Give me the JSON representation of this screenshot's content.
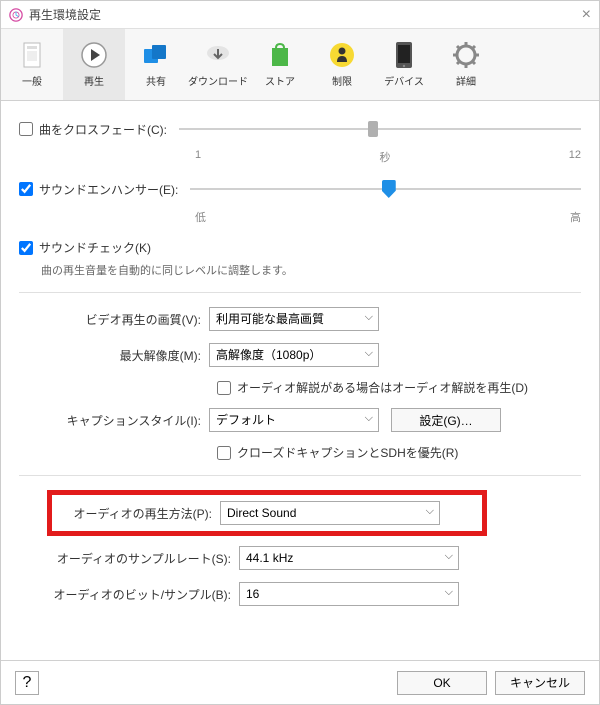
{
  "title": "再生環境設定",
  "tabs": [
    {
      "label": "一般"
    },
    {
      "label": "再生"
    },
    {
      "label": "共有"
    },
    {
      "label": "ダウンロード"
    },
    {
      "label": "ストア"
    },
    {
      "label": "制限"
    },
    {
      "label": "デバイス"
    },
    {
      "label": "詳細"
    }
  ],
  "crossfade": {
    "label": "曲をクロスフェード(C):",
    "min": "1",
    "unit": "秒",
    "max": "12"
  },
  "enhancer": {
    "label": "サウンドエンハンサー(E):",
    "low": "低",
    "high": "高"
  },
  "soundcheck": {
    "label": "サウンドチェック(K)",
    "desc": "曲の再生音量を自動的に同じレベルに調整します。"
  },
  "video_quality": {
    "label": "ビデオ再生の画質(V):",
    "value": "利用可能な最高画質"
  },
  "max_res": {
    "label": "最大解像度(M):",
    "value": "高解像度（1080p）"
  },
  "audio_desc": {
    "label": "オーディオ解説がある場合はオーディオ解説を再生(D)"
  },
  "caption_style": {
    "label": "キャプションスタイル(I):",
    "value": "デフォルト",
    "settings_btn": "設定(G)…"
  },
  "cc": {
    "label": "クローズドキャプションとSDHを優先(R)"
  },
  "playback_method": {
    "label": "オーディオの再生方法(P):",
    "value": "Direct Sound"
  },
  "sample_rate": {
    "label": "オーディオのサンプルレート(S):",
    "value": "44.1 kHz"
  },
  "bits": {
    "label": "オーディオのビット/サンプル(B):",
    "value": "16"
  },
  "help": "?",
  "ok": "OK",
  "cancel": "キャンセル"
}
